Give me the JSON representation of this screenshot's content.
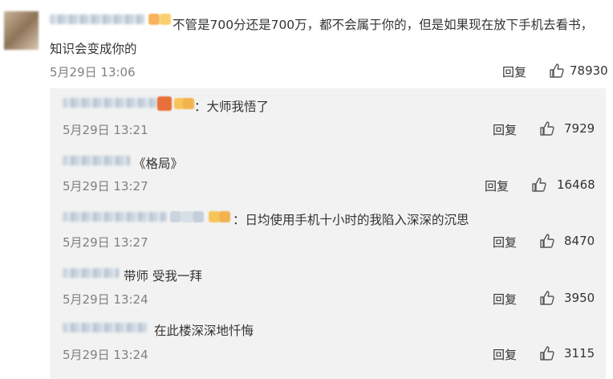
{
  "main_comment": {
    "text_line1": "不管是700分还是700万，都不会属于你的，但是如果现在放下手机去看书，",
    "text_line2": "知识会变成你的",
    "date": "5月29日 13:06",
    "reply_label": "回复",
    "likes": "78930"
  },
  "replies": [
    {
      "text": "：大师我悟了",
      "date": "5月29日 13:21",
      "reply_label": "回复",
      "likes": "7929"
    },
    {
      "text": "《格局》",
      "date": "5月29日 13:27",
      "reply_label": "回复",
      "likes": "16468"
    },
    {
      "text": "：日均使用手机十小时的我陷入深深的沉思",
      "date": "5月29日 13:27",
      "reply_label": "回复",
      "likes": "8470"
    },
    {
      "text": "带师 受我一拜",
      "date": "5月29日 13:24",
      "reply_label": "回复",
      "likes": "3950"
    },
    {
      "text": "在此楼深深地忏悔",
      "date": "5月29日 13:24",
      "reply_label": "回复",
      "likes": "3115"
    }
  ],
  "icons": {
    "like": "thumbs-up-icon",
    "avatar": "avatar"
  }
}
